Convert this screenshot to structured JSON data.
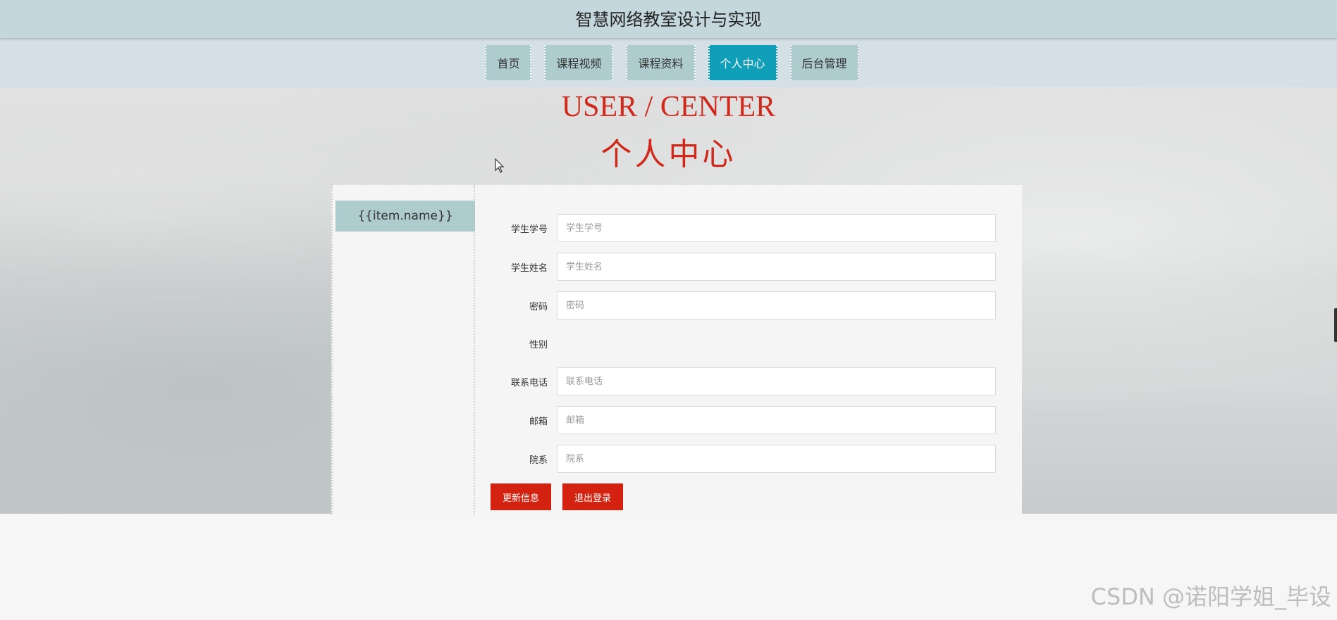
{
  "header": {
    "site_title": "智慧网络教室设计与实现"
  },
  "nav": {
    "items": [
      {
        "label": "首页",
        "active": false
      },
      {
        "label": "课程视频",
        "active": false
      },
      {
        "label": "课程资料",
        "active": false
      },
      {
        "label": "个人中心",
        "active": true
      },
      {
        "label": "后台管理",
        "active": false
      }
    ]
  },
  "hero": {
    "heading_en": "USER / CENTER",
    "heading_cn": "个人中心"
  },
  "sidebar": {
    "item_label": "{{item.name}}"
  },
  "form": {
    "fields": [
      {
        "label": "学生学号",
        "placeholder": "学生学号",
        "value": ""
      },
      {
        "label": "学生姓名",
        "placeholder": "学生姓名",
        "value": ""
      },
      {
        "label": "密码",
        "placeholder": "密码",
        "value": ""
      },
      {
        "label": "性别"
      },
      {
        "label": "联系电话",
        "placeholder": "联系电话",
        "value": ""
      },
      {
        "label": "邮箱",
        "placeholder": "邮箱",
        "value": ""
      },
      {
        "label": "院系",
        "placeholder": "院系",
        "value": ""
      }
    ],
    "update_button": "更新信息",
    "logout_button": "退出登录"
  },
  "watermark": "CSDN @诺阳学姐_毕设",
  "colors": {
    "header_bg": "#c3d7dc",
    "nav_bg": "#d4e0e6",
    "nav_item_bg": "#aecbcd",
    "nav_active_bg": "#0f9fb8",
    "heading_red": "#d0291c",
    "button_red": "#d3220f"
  }
}
